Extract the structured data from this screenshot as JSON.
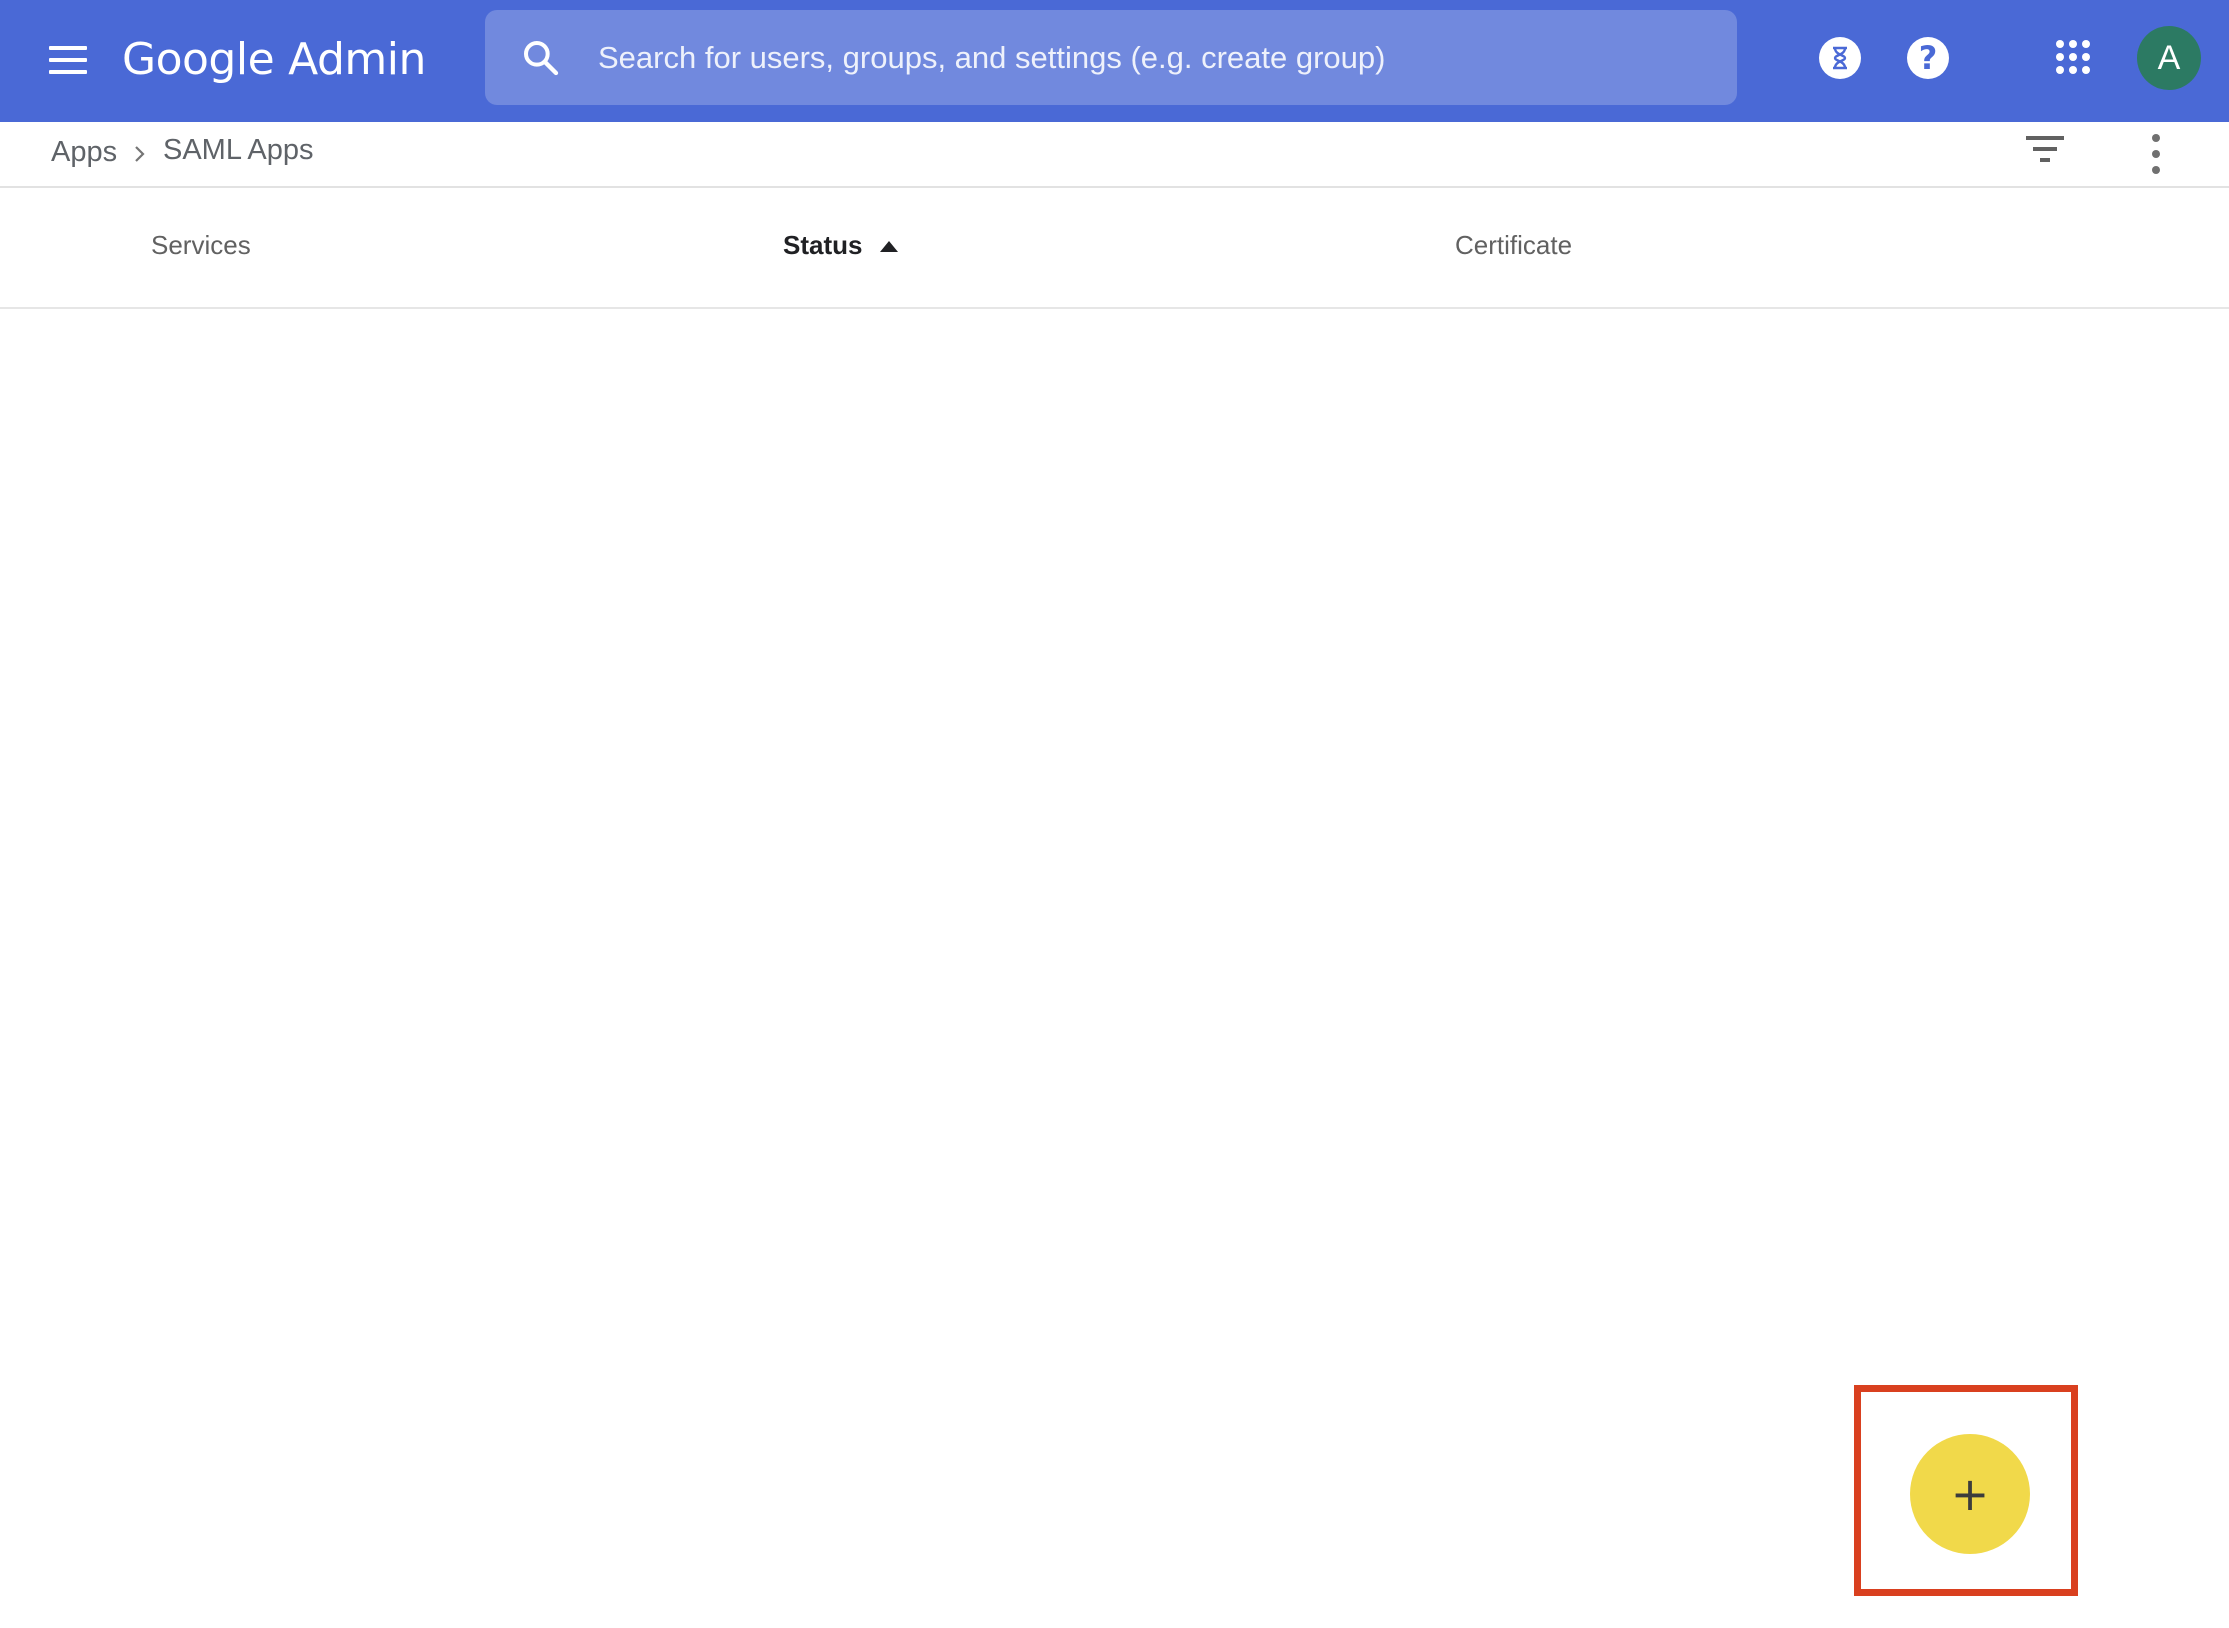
{
  "header": {
    "logo_brand": "Google",
    "logo_product": "Admin",
    "search": {
      "placeholder": "Search for users, groups, and settings (e.g. create group)",
      "value": ""
    },
    "avatar_initial": "A",
    "help_label": "?"
  },
  "breadcrumb": {
    "items": [
      {
        "label": "Apps"
      },
      {
        "label": "SAML Apps"
      }
    ]
  },
  "table": {
    "columns": [
      {
        "label": "Services"
      },
      {
        "label": "Status",
        "sorted": "ascending"
      },
      {
        "label": "Certificate"
      }
    ],
    "rows": []
  },
  "fab": {
    "label": "+"
  },
  "colors": {
    "topbar": "#4a69d6",
    "search_box": "#7189de",
    "avatar": "#2c7a63",
    "fab": "#f1d94a",
    "highlight": "#d9401f"
  },
  "icons": [
    "menu-icon",
    "search-icon",
    "hourglass-icon",
    "help-icon",
    "apps-grid-icon",
    "chevron-right-icon",
    "filter-icon",
    "more-vert-icon",
    "add-icon"
  ]
}
